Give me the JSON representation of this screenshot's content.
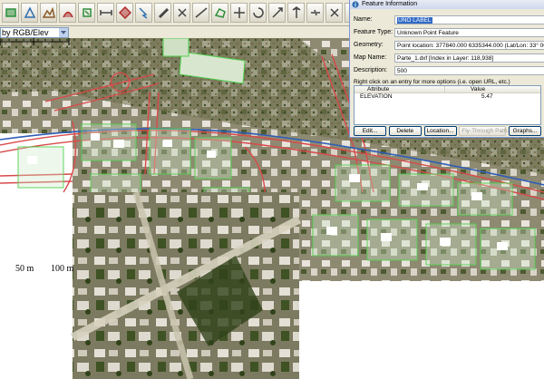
{
  "toolbar": {
    "buttons": [
      {
        "icon": "layers-icon",
        "color": "#2c8f3a"
      },
      {
        "icon": "digitize-icon",
        "color": "#2c6fb0"
      },
      {
        "icon": "terrain-icon",
        "color": "#8a5a2a"
      },
      {
        "icon": "path-icon",
        "color": "#b02c2c"
      },
      {
        "icon": "shape-icon",
        "color": "#2c8f3a"
      },
      {
        "icon": "measure-icon",
        "color": "#444444"
      },
      {
        "icon": "feature-info-icon",
        "color": "#b02c2c"
      },
      {
        "icon": "select-icon",
        "color": "#2c6fb0"
      },
      {
        "icon": "edit-icon",
        "color": "#444444"
      },
      {
        "icon": "vertex-icon",
        "color": "#444444"
      },
      {
        "icon": "line-icon",
        "color": "#444444"
      },
      {
        "icon": "area-icon",
        "color": "#2c8f3a"
      },
      {
        "icon": "move-icon",
        "color": "#444444"
      },
      {
        "icon": "rotate-icon",
        "color": "#444444"
      },
      {
        "icon": "scale-icon",
        "color": "#444444"
      },
      {
        "icon": "split-icon",
        "color": "#444444"
      },
      {
        "icon": "join-icon",
        "color": "#444444"
      },
      {
        "icon": "cut-icon",
        "color": "#444444"
      },
      {
        "icon": "snap-icon",
        "color": "#2c6fb0"
      },
      {
        "icon": "copy-icon",
        "color": "#444444"
      },
      {
        "icon": "delete-icon",
        "color": "#b02c2c"
      }
    ]
  },
  "shader": {
    "value": "by RGB/Elev"
  },
  "scale": {
    "label_50": "50 m",
    "label_100": "100 m"
  },
  "dialog": {
    "title": "Feature Information",
    "fields": {
      "name_label": "Name:",
      "name_value": "UNO LABEL",
      "type_label": "Feature Type:",
      "type_value": "Unknown Point Feature",
      "geometry_label": "Geometry:",
      "geometry_value": "Point location: 377840.000 6335344.000 (Lat/Lon: 33° 06' 49.3697\"",
      "mapname_label": "Map Name:",
      "mapname_value": "Parte_1.dxf [Index in Layer: 118,938]",
      "description_label": "Description:",
      "description_value": "500"
    },
    "hint": "Right click on an entry for more options (i.e. open URL, etc.)",
    "table": {
      "headers": [
        "Attribute",
        "Value"
      ],
      "rows": [
        [
          "ELEVATION",
          "5.47"
        ]
      ]
    },
    "buttons": {
      "edit": "Edit...",
      "delete": "Delete",
      "location": "Location...",
      "flythrough": "Fly-Through Path...",
      "graphs": "Graphs..."
    }
  },
  "colors": {
    "road_outline": "#d84a4a",
    "parcel_outline": "#4fd04f",
    "highway": "#2e5db8",
    "vegetation": "#5f7a3a"
  }
}
